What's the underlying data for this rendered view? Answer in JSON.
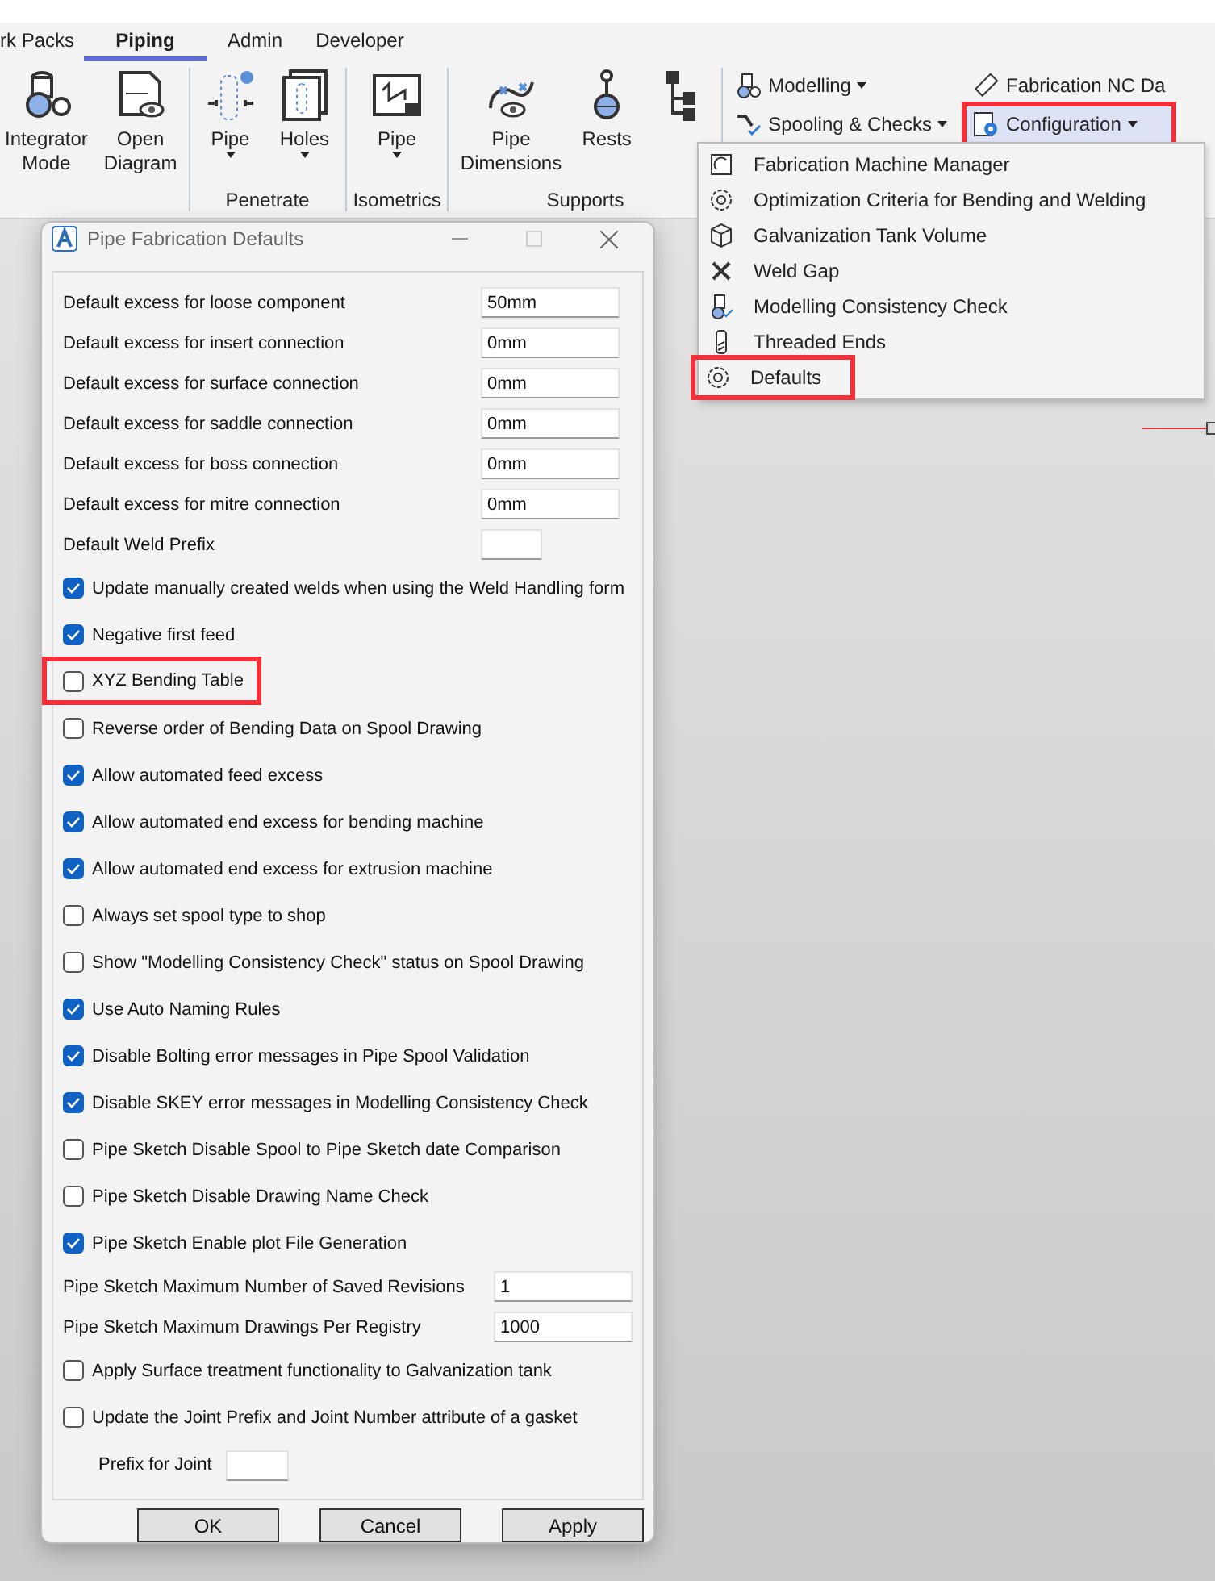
{
  "ribbon": {
    "tabs": [
      {
        "label": "rk Packs",
        "selected": false
      },
      {
        "label": "Piping",
        "selected": true
      },
      {
        "label": "Admin",
        "selected": false
      },
      {
        "label": "Developer",
        "selected": false
      }
    ],
    "groups": [
      {
        "buttons": [
          {
            "label": "Integrator Mode",
            "dropdown": false
          },
          {
            "label": "Open Diagram",
            "dropdown": false
          }
        ]
      },
      {
        "label": "Penetrate",
        "buttons": [
          {
            "label": "Pipe",
            "dropdown": true
          },
          {
            "label": "Holes",
            "dropdown": true
          }
        ]
      },
      {
        "label": "Isometrics",
        "buttons": [
          {
            "label": "Pipe",
            "dropdown": true
          }
        ]
      },
      {
        "label": "Supports",
        "buttons": [
          {
            "label": "Pipe Dimensions",
            "dropdown": false
          },
          {
            "label": "Rests",
            "dropdown": false
          },
          {
            "dropdown": false
          }
        ]
      }
    ],
    "small_buttons": [
      {
        "label": "Modelling",
        "dropdown": true,
        "active": false,
        "highlighted": false
      },
      {
        "label": "Spooling & Checks",
        "dropdown": true,
        "active": false,
        "highlighted": false
      },
      {
        "label": "Fabrication NC Da",
        "dropdown": false,
        "active": false,
        "highlighted": false
      },
      {
        "label": "Configuration",
        "dropdown": true,
        "active": true,
        "highlighted": true
      }
    ]
  },
  "menu": {
    "items": [
      {
        "label": "Fabrication Machine Manager",
        "highlighted": false
      },
      {
        "label": "Optimization Criteria for Bending and Welding",
        "highlighted": false
      },
      {
        "label": "Galvanization Tank Volume",
        "highlighted": false
      },
      {
        "label": "Weld Gap",
        "highlighted": false
      },
      {
        "label": "Modelling Consistency Check",
        "highlighted": false
      },
      {
        "label": "Threaded Ends",
        "highlighted": false
      },
      {
        "label": "Defaults",
        "highlighted": true
      }
    ]
  },
  "dialog": {
    "title": "Pipe Fabrication Defaults",
    "rows": [
      {
        "kind": "field",
        "label": "Default excess for loose component",
        "value": "50mm"
      },
      {
        "kind": "field",
        "label": "Default excess for insert connection",
        "value": "0mm"
      },
      {
        "kind": "field",
        "label": "Default excess for surface connection",
        "value": "0mm"
      },
      {
        "kind": "field",
        "label": "Default excess for saddle connection",
        "value": "0mm"
      },
      {
        "kind": "field",
        "label": "Default excess for boss connection",
        "value": "0mm"
      },
      {
        "kind": "field",
        "label": "Default excess for mitre connection",
        "value": "0mm"
      },
      {
        "kind": "short-field",
        "label": "Default Weld Prefix"
      },
      {
        "kind": "check",
        "label": "Update manually created welds when using the Weld Handling form",
        "checked": true,
        "highlighted": false
      },
      {
        "kind": "check",
        "label": "Negative first feed",
        "checked": true,
        "highlighted": false
      },
      {
        "kind": "check",
        "label": "XYZ Bending Table",
        "checked": false,
        "highlighted": true
      },
      {
        "kind": "check",
        "label": "Reverse order of Bending Data on Spool Drawing",
        "checked": false,
        "highlighted": false
      },
      {
        "kind": "check",
        "label": "Allow automated feed excess",
        "checked": true,
        "highlighted": false
      },
      {
        "kind": "check",
        "label": "Allow automated end excess for bending machine",
        "checked": true,
        "highlighted": false
      },
      {
        "kind": "check",
        "label": "Allow automated end excess for extrusion machine",
        "checked": true,
        "highlighted": false
      },
      {
        "kind": "check",
        "label": "Always set spool type to shop",
        "checked": false,
        "highlighted": false
      },
      {
        "kind": "check",
        "label": "Show \"Modelling Consistency Check\" status on Spool Drawing",
        "checked": false,
        "highlighted": false
      },
      {
        "kind": "check",
        "label": "Use Auto Naming Rules",
        "checked": true,
        "highlighted": false
      },
      {
        "kind": "check",
        "label": "Disable Bolting error messages in Pipe Spool Validation",
        "checked": true,
        "highlighted": false
      },
      {
        "kind": "check",
        "label": "Disable SKEY error messages in Modelling Consistency Check",
        "checked": true,
        "highlighted": false
      },
      {
        "kind": "check",
        "label": "Pipe Sketch Disable Spool to Pipe Sketch date Comparison",
        "checked": false,
        "highlighted": false
      },
      {
        "kind": "check",
        "label": "Pipe Sketch Disable Drawing Name Check",
        "checked": false,
        "highlighted": false
      },
      {
        "kind": "check",
        "label": "Pipe Sketch Enable plot File Generation",
        "checked": true,
        "highlighted": false
      },
      {
        "kind": "wide-field",
        "label": "Pipe Sketch Maximum Number of Saved Revisions",
        "value": "1"
      },
      {
        "kind": "wide-field",
        "label": "Pipe Sketch Maximum Drawings Per Registry",
        "value": "1000"
      },
      {
        "kind": "check",
        "label": "Apply Surface treatment functionality to Galvanization tank",
        "checked": false,
        "highlighted": false
      },
      {
        "kind": "check",
        "label": "Update the Joint Prefix and Joint Number attribute of a gasket",
        "checked": false,
        "highlighted": false
      },
      {
        "kind": "indent-field",
        "label": "Prefix for Joint"
      }
    ],
    "buttons": [
      "OK",
      "Cancel",
      "Apply"
    ]
  }
}
